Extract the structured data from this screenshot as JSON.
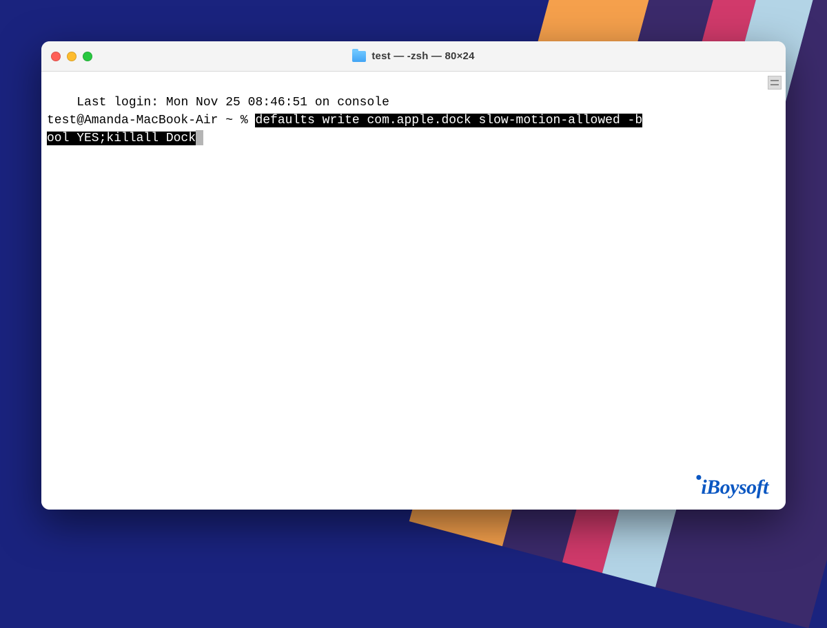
{
  "window": {
    "title": "test — -zsh — 80×24"
  },
  "terminal": {
    "last_login": "Last login: Mon Nov 25 08:46:51 on console",
    "prompt": "test@Amanda-MacBook-Air ~ % ",
    "command_line1": "defaults write com.apple.dock slow-motion-allowed -b",
    "command_line2": "ool YES;killall Dock"
  },
  "watermark": {
    "text": "iBoysoft"
  }
}
